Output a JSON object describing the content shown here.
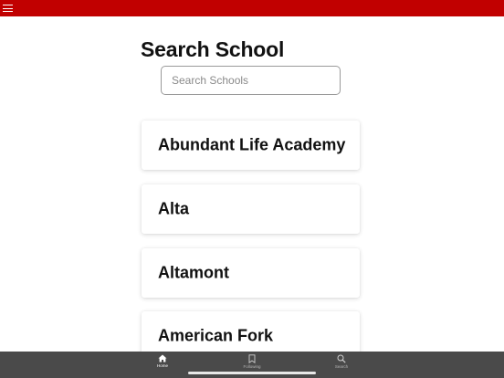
{
  "app": {
    "header_color": "#c10000",
    "menu_icon": "hamburger-menu-icon"
  },
  "page": {
    "title": "Search School"
  },
  "search": {
    "value": "",
    "placeholder": "Search Schools"
  },
  "schools": [
    {
      "name": "Abundant Life Academy"
    },
    {
      "name": "Alta"
    },
    {
      "name": "Altamont"
    },
    {
      "name": "American Fork"
    }
  ],
  "tabbar": {
    "background": "#4a4a4a",
    "tabs": [
      {
        "label": "Home",
        "icon": "home-icon",
        "active": true
      },
      {
        "label": "Following",
        "icon": "bookmark-icon",
        "active": false
      },
      {
        "label": "Search",
        "icon": "search-icon",
        "active": false
      }
    ]
  }
}
